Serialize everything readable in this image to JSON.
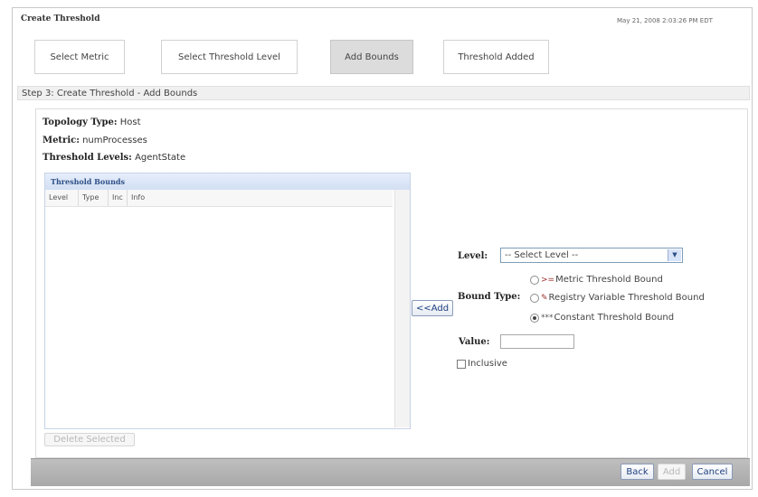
{
  "window": {
    "title": "Create Threshold",
    "timestamp": "May 21, 2008 2:03:26 PM EDT"
  },
  "steps": [
    {
      "label": "Select Metric",
      "active": false
    },
    {
      "label": "Select Threshold Level",
      "active": false
    },
    {
      "label": "Add Bounds",
      "active": true
    },
    {
      "label": "Threshold Added",
      "active": false
    }
  ],
  "step_banner": "Step 3: Create Threshold - Add Bounds",
  "info": {
    "topology_label": "Topology Type:",
    "topology_value": "Host",
    "metric_label": "Metric:",
    "metric_value": "numProcesses",
    "levels_label": "Threshold Levels:",
    "levels_value": "AgentState"
  },
  "grid": {
    "title": "Threshold Bounds",
    "columns": [
      "Level",
      "Type",
      "Inc",
      "Info"
    ],
    "rows": []
  },
  "buttons": {
    "delete_selected": "Delete Selected",
    "add_bound": "<<Add",
    "back": "Back",
    "add": "Add",
    "cancel": "Cancel"
  },
  "form": {
    "level_label": "Level:",
    "level_selected": "-- Select Level --",
    "bound_type_label": "Bound Type:",
    "bound_types": [
      {
        "icon": ">=",
        "label": "Metric Threshold Bound",
        "checked": false
      },
      {
        "icon": "✎",
        "label": "Registry Variable Threshold Bound",
        "checked": false
      },
      {
        "icon": "***",
        "label": "Constant Threshold Bound",
        "checked": true
      }
    ],
    "value_label": "Value:",
    "value": "",
    "inclusive_label": "Inclusive",
    "inclusive_checked": false
  }
}
